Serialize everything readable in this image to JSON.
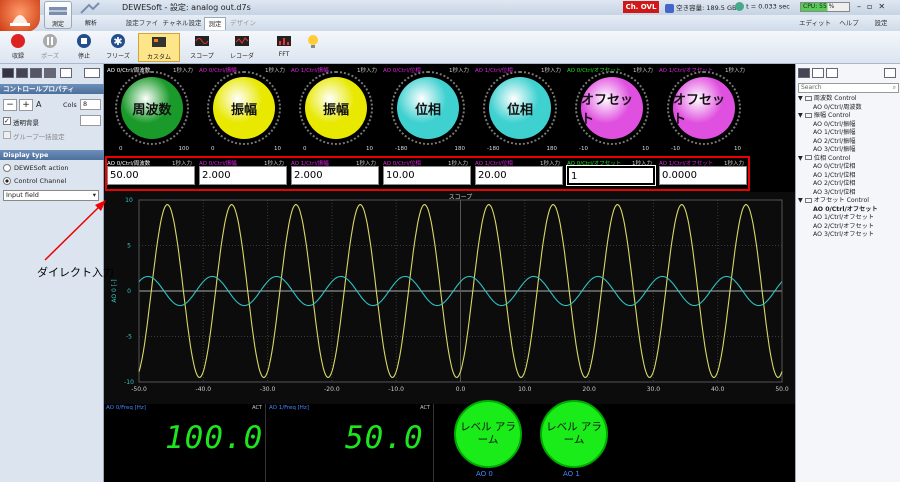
{
  "window": {
    "title": "DEWESoft - 設定: analog out.d7s",
    "ch_ovl": "Ch. OVL",
    "disk": "空き容量: 189.5 GB",
    "time": "t = 0.033 sec",
    "cpu": "CPU: 55 %",
    "home_labels": [
      "測定",
      "解析"
    ]
  },
  "menu": {
    "tabs": [
      "設定ファイル",
      "チャネル設定",
      "測定",
      "デザイン"
    ],
    "right": [
      "エディット",
      "ヘルプ",
      "設定"
    ]
  },
  "toolbar": {
    "buttons": [
      "収録",
      "ポーズ",
      "停止",
      "フリーズ",
      "カスタム",
      "スコープ",
      "レコーダ",
      "FFT"
    ]
  },
  "left": {
    "control_props": "コントロールプロパティ",
    "cols_label": "Cols",
    "cols_value": "8",
    "transparent": "透明背景",
    "group_label": "グループ一括設定",
    "display_type": "Display type",
    "opt1": "DEWESoft action",
    "opt2": "Control Channel",
    "select": "Input field"
  },
  "knobs": [
    {
      "label": "AO 0/Ctrl/周波数",
      "unit": "1秒入力",
      "text": "周波数",
      "min": "0",
      "max": "100",
      "color": "#1a9a2a",
      "lblcolor": "#fff"
    },
    {
      "label": "AO 0/Ctrl/振幅",
      "unit": "1秒入力",
      "text": "振幅",
      "min": "0",
      "max": "10",
      "color": "#e8e800",
      "lblcolor": "#e020e0"
    },
    {
      "label": "AO 1/Ctrl/振幅",
      "unit": "1秒入力",
      "text": "振幅",
      "min": "0",
      "max": "10",
      "color": "#e8e800",
      "lblcolor": "#e020e0"
    },
    {
      "label": "AO 0/Ctrl/位相",
      "unit": "1秒入力",
      "text": "位相",
      "min": "-180",
      "max": "180",
      "color": "#3fd0d0",
      "lblcolor": "#e020e0"
    },
    {
      "label": "AO 1/Ctrl/位相",
      "unit": "1秒入力",
      "text": "位相",
      "min": "-180",
      "max": "180",
      "color": "#3fd0d0",
      "lblcolor": "#e020e0"
    },
    {
      "label": "AO 0/Ctrl/オフセット",
      "unit": "1秒入力",
      "text": "オフセット",
      "min": "-10",
      "max": "10",
      "color": "#e050e0",
      "lblcolor": "#1fe51f"
    },
    {
      "label": "AO 1/Ctrl/オフセット",
      "unit": "1秒入力",
      "text": "オフセット",
      "min": "-10",
      "max": "10",
      "color": "#e050e0",
      "lblcolor": "#e020e0"
    }
  ],
  "inputs": [
    {
      "label": "AO 0/Ctrl/周波数",
      "unit": "1秒入力",
      "value": "50.00",
      "lblcolor": "#fff"
    },
    {
      "label": "AO 0/Ctrl/振幅",
      "unit": "1秒入力",
      "value": "2.000",
      "lblcolor": "#e020e0"
    },
    {
      "label": "AO 1/Ctrl/振幅",
      "unit": "1秒入力",
      "value": "2.000",
      "lblcolor": "#e020e0"
    },
    {
      "label": "AO 0/Ctrl/位相",
      "unit": "1秒入力",
      "value": "10.00",
      "lblcolor": "#e020e0"
    },
    {
      "label": "AO 1/Ctrl/位相",
      "unit": "1秒入力",
      "value": "20.00",
      "lblcolor": "#e020e0"
    },
    {
      "label": "AO 0/Ctrl/オフセット",
      "unit": "1秒入力",
      "value": "1",
      "lblcolor": "#1fe51f"
    },
    {
      "label": "AO 1/Ctrl/オフセット",
      "unit": "1秒入力",
      "value": "0.0000",
      "lblcolor": "#e020e0"
    }
  ],
  "scope": {
    "title": "スコープ",
    "ylabel": "AO 0 [-]",
    "xticks": [
      "-50.0",
      "-40.0",
      "-30.0",
      "-20.0",
      "-10.0",
      "0.0",
      "10.0",
      "20.0",
      "30.0",
      "40.0",
      "50.0"
    ],
    "yticks": [
      "10",
      "5",
      "0",
      "-5",
      "-10"
    ],
    "amp0": 9.5,
    "amp1": 1.6,
    "cycles": 10,
    "color0": "#d8d868",
    "color1": "#30c0c0"
  },
  "bottom": {
    "d1_label": "AO 0/Freq [Hz]",
    "d1_value": "100.0",
    "d2_label": "AO 1/Freq [Hz]",
    "d2_value": "50.0",
    "act": "ACT",
    "alarm_text": "レベル アラーム",
    "alarms": [
      "AO 0",
      "AO 1"
    ]
  },
  "tree": {
    "search": "Search",
    "groups": [
      {
        "name": "周波数 Control",
        "items": [
          "AO 0/Ctrl/周波数"
        ]
      },
      {
        "name": "振幅 Control",
        "items": [
          "AO 0/Ctrl/振幅",
          "AO 1/Ctrl/振幅",
          "AO 2/Ctrl/振幅",
          "AO 3/Ctrl/振幅"
        ]
      },
      {
        "name": "位相 Control",
        "items": [
          "AO 0/Ctrl/位相",
          "AO 1/Ctrl/位相",
          "AO 2/Ctrl/位相",
          "AO 3/Ctrl/位相"
        ]
      },
      {
        "name": "オフセット Control",
        "items": [
          "AO 0/Ctrl/オフセット",
          "AO 1/Ctrl/オフセット",
          "AO 2/Ctrl/オフセット",
          "AO 3/Ctrl/オフセット"
        ]
      }
    ]
  },
  "annotation": "ダイレクト入力"
}
